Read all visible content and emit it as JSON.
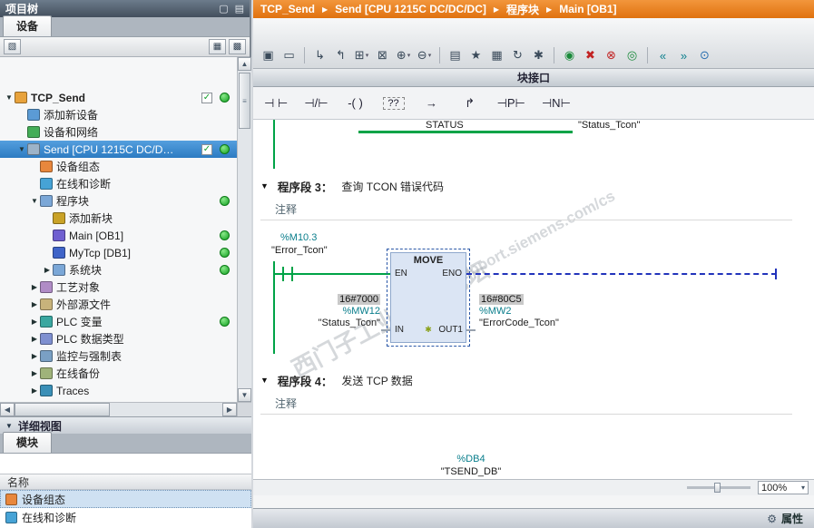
{
  "project_tree": {
    "title": "项目树",
    "tab": "设备",
    "header_icons": [
      {
        "name": "panel-window-icon",
        "glyph": "▢"
      },
      {
        "name": "panel-menu-icon",
        "glyph": "▤"
      }
    ],
    "toolbar_icons": [
      {
        "name": "new-item-icon",
        "glyph": "▧"
      },
      {
        "name": "column-view-icon",
        "glyph": "▦"
      },
      {
        "name": "split-view-icon",
        "glyph": "▩"
      }
    ],
    "check_glyph": "✓",
    "items": [
      {
        "label": "TCP_Send",
        "icon": "project-icon",
        "expander": "▼",
        "check": "ok",
        "status": "online-green"
      },
      {
        "label": "添加新设备",
        "icon": "add-device-icon",
        "expander": ""
      },
      {
        "label": "设备和网络",
        "icon": "devices-networks-icon",
        "expander": ""
      },
      {
        "label": "Send [CPU 1215C DC/DC/...",
        "icon": "plc-device-icon",
        "expander": "▼",
        "check": "ok",
        "status": "online-green",
        "selected": true
      },
      {
        "label": "设备组态",
        "icon": "device-config-icon",
        "expander": ""
      },
      {
        "label": "在线和诊断",
        "icon": "online-diagnostics-icon",
        "expander": ""
      },
      {
        "label": "程序块",
        "icon": "program-blocks-folder-icon",
        "expander": "▼",
        "status": "online-green"
      },
      {
        "label": "添加新块",
        "icon": "add-block-icon",
        "expander": ""
      },
      {
        "label": "Main [OB1]",
        "icon": "ob-block-icon",
        "expander": "",
        "status": "online-green"
      },
      {
        "label": "MyTcp [DB1]",
        "icon": "db-block-icon",
        "expander": "",
        "status": "online-green"
      },
      {
        "label": "系统块",
        "icon": "system-blocks-folder-icon",
        "expander": "▶",
        "status": "online-green"
      },
      {
        "label": "工艺对象",
        "icon": "technology-objects-folder-icon",
        "expander": "▶"
      },
      {
        "label": "外部源文件",
        "icon": "external-sources-folder-icon",
        "expander": "▶"
      },
      {
        "label": "PLC 变量",
        "icon": "plc-tags-icon",
        "expander": "▶",
        "status": "online-green"
      },
      {
        "label": "PLC 数据类型",
        "icon": "plc-data-types-icon",
        "expander": "▶"
      },
      {
        "label": "监控与强制表",
        "icon": "watch-tables-folder-icon",
        "expander": "▶"
      },
      {
        "label": "在线备份",
        "icon": "online-backups-folder-icon",
        "expander": "▶"
      },
      {
        "label": "Traces",
        "icon": "traces-icon",
        "expander": "▶"
      }
    ]
  },
  "detail_view": {
    "collapse_icon": "▼",
    "title": "详细视图",
    "tab": "模块",
    "name_header": "名称",
    "rows": [
      {
        "label": "设备组态",
        "icon": "device-config-icon"
      },
      {
        "label": "在线和诊断",
        "icon": "online-diagnostics-icon"
      }
    ]
  },
  "scrollbar": {
    "up": "▲",
    "down": "▼",
    "left": "◀",
    "right": "▶",
    "grip": "≡"
  },
  "breadcrumb": {
    "separator": "▶",
    "items": [
      "TCP_Send",
      "Send [CPU 1215C DC/DC/DC]",
      "程序块",
      "Main [OB1]"
    ]
  },
  "toolbar": {
    "icons": [
      {
        "name": "absolute-operands-icon",
        "glyph": "▣"
      },
      {
        "name": "network-title-icon",
        "glyph": "▭"
      },
      {
        "name": "open-branch-icon",
        "glyph": "↳"
      },
      {
        "name": "close-branch-icon",
        "glyph": "↰"
      },
      {
        "name": "insert-network-icon",
        "glyph": "⊞"
      },
      {
        "name": "delete-network-icon",
        "glyph": "⊠"
      },
      {
        "name": "expand-networks-icon",
        "glyph": "⊕"
      },
      {
        "name": "collapse-networks-icon",
        "glyph": "⊖"
      },
      {
        "name": "show-comments-icon",
        "glyph": "▤"
      },
      {
        "name": "favorites-icon",
        "glyph": "★"
      },
      {
        "name": "free-form-logic-icon",
        "glyph": "▦"
      },
      {
        "name": "update-block-calls-icon",
        "glyph": "↻"
      },
      {
        "name": "snapshot-icon",
        "glyph": "✱"
      },
      {
        "name": "go-online-icon",
        "glyph": "◉"
      },
      {
        "name": "go-offline-icon",
        "glyph": "✖"
      },
      {
        "name": "stop-action-icon",
        "glyph": "⊗"
      },
      {
        "name": "monitor-onoff-icon",
        "glyph": "◎"
      },
      {
        "name": "jump-previous-icon",
        "glyph": "«"
      },
      {
        "name": "jump-next-icon",
        "glyph": "»"
      },
      {
        "name": "search-icon",
        "glyph": "⊙"
      }
    ]
  },
  "block_interface_label": "块接口",
  "favorites": [
    {
      "name": "no-contact-icon",
      "glyph": "⊣ ⊢"
    },
    {
      "name": "nc-contact-icon",
      "glyph": "⊣/⊢"
    },
    {
      "name": "coil-icon",
      "glyph": "-( )"
    },
    {
      "name": "empty-box-icon",
      "glyph": "??"
    },
    {
      "name": "open-branch-icon",
      "glyph": "→"
    },
    {
      "name": "close-branch-icon",
      "glyph": "↱"
    },
    {
      "name": "p-trigger-icon",
      "glyph": "⊣P⊢"
    },
    {
      "name": "n-trigger-icon",
      "glyph": "⊣N⊢"
    }
  ],
  "editor": {
    "prev_network": {
      "pin_label": "STATUS",
      "operand": "\"Status_Tcon\""
    },
    "network3": {
      "collapse_icon": "▼",
      "title": "程序段 3：",
      "subtitle": "查询 TCON 错误代码",
      "comment": "注释",
      "contact": {
        "operand": "%M10.3",
        "name": "\"Error_Tcon\""
      },
      "move_box": {
        "title": "MOVE",
        "pin_en": "EN",
        "pin_eno": "ENO",
        "pin_in": "IN",
        "pin_out1": "OUT1",
        "indicator": "✱",
        "in_monitor": "16#7000",
        "in_operand": "%MW12",
        "in_name": "\"Status_Tcon\"",
        "out_monitor": "16#80C5",
        "out_operand": "%MW2",
        "out_name": "\"ErrorCode_Tcon\""
      }
    },
    "network4": {
      "collapse_icon": "▼",
      "title": "程序段 4：",
      "subtitle": "发送 TCP 数据",
      "comment": "注释",
      "db_operand": "%DB4",
      "db_name": "\"TSEND_DB\""
    },
    "zoom": "100%",
    "zoom_dd": "▾"
  },
  "status_bar": {
    "icon_glyph": "⚙",
    "properties_label": "属性"
  },
  "watermark": {
    "line1": "西门子工业 技术论坛",
    "line2": "support.siemens.com/cs"
  },
  "colors": {
    "accent_orange": "#e8791a",
    "online_green": "#00a347",
    "operand_teal": "#0a7e8c",
    "selection_blue": "#3d87d1",
    "monitor_gray": "#c9c9c9",
    "dashed_blue": "#2233bb"
  }
}
